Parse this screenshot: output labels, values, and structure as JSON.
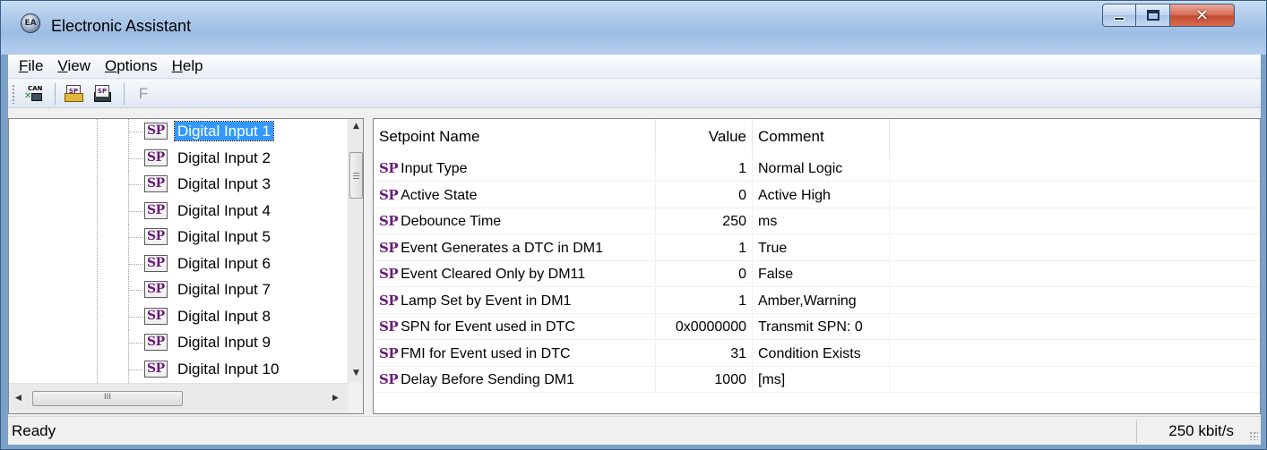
{
  "window": {
    "title": "Electronic Assistant",
    "app_icon_text": "EA"
  },
  "menu": [
    {
      "label": "File",
      "accel": "F",
      "rest": "ile"
    },
    {
      "label": "View",
      "accel": "V",
      "rest": "iew"
    },
    {
      "label": "Options",
      "accel": "O",
      "rest": "ptions"
    },
    {
      "label": "Help",
      "accel": "H",
      "rest": "elp"
    }
  ],
  "toolbar": {
    "can_icon_text": "CAN",
    "open_setpoint_icon_text": "SP",
    "save_setpoint_icon_text": "SP",
    "f_label": "F"
  },
  "tree": {
    "badge": "SP",
    "items": [
      {
        "label": "Digital Input 1",
        "selected": true
      },
      {
        "label": "Digital Input 2",
        "selected": false
      },
      {
        "label": "Digital Input 3",
        "selected": false
      },
      {
        "label": "Digital Input 4",
        "selected": false
      },
      {
        "label": "Digital Input 5",
        "selected": false
      },
      {
        "label": "Digital Input 6",
        "selected": false
      },
      {
        "label": "Digital Input 7",
        "selected": false
      },
      {
        "label": "Digital Input 8",
        "selected": false
      },
      {
        "label": "Digital Input 9",
        "selected": false
      },
      {
        "label": "Digital Input 10",
        "selected": false
      }
    ],
    "hscroll_grip": "III"
  },
  "table": {
    "headers": {
      "name": "Setpoint Name",
      "value": "Value",
      "comment": "Comment"
    },
    "badge": "SP",
    "rows": [
      {
        "name": "Input Type",
        "value": "1",
        "comment": "Normal Logic"
      },
      {
        "name": "Active State",
        "value": "0",
        "comment": "Active High"
      },
      {
        "name": "Debounce Time",
        "value": "250",
        "comment": "ms"
      },
      {
        "name": "Event Generates a DTC in DM1",
        "value": "1",
        "comment": "True"
      },
      {
        "name": "Event Cleared Only by DM11",
        "value": "0",
        "comment": "False"
      },
      {
        "name": "Lamp Set by Event in DM1",
        "value": "1",
        "comment": "Amber,Warning"
      },
      {
        "name": "SPN for Event used in DTC",
        "value": "0x0000000",
        "comment": "Transmit SPN: 0"
      },
      {
        "name": "FMI for Event used in DTC",
        "value": "31",
        "comment": "Condition Exists"
      },
      {
        "name": "Delay Before Sending DM1",
        "value": "1000",
        "comment": "[ms]"
      }
    ]
  },
  "status": {
    "left": "Ready",
    "right": "250 kbit/s"
  },
  "colors": {
    "selection": "#3399ff",
    "sp_badge": "#6a1b7a",
    "close_button": "#c44d33"
  },
  "icons": {
    "minimize": "minimize-icon",
    "maximize": "maximize-icon",
    "close": "close-icon"
  }
}
